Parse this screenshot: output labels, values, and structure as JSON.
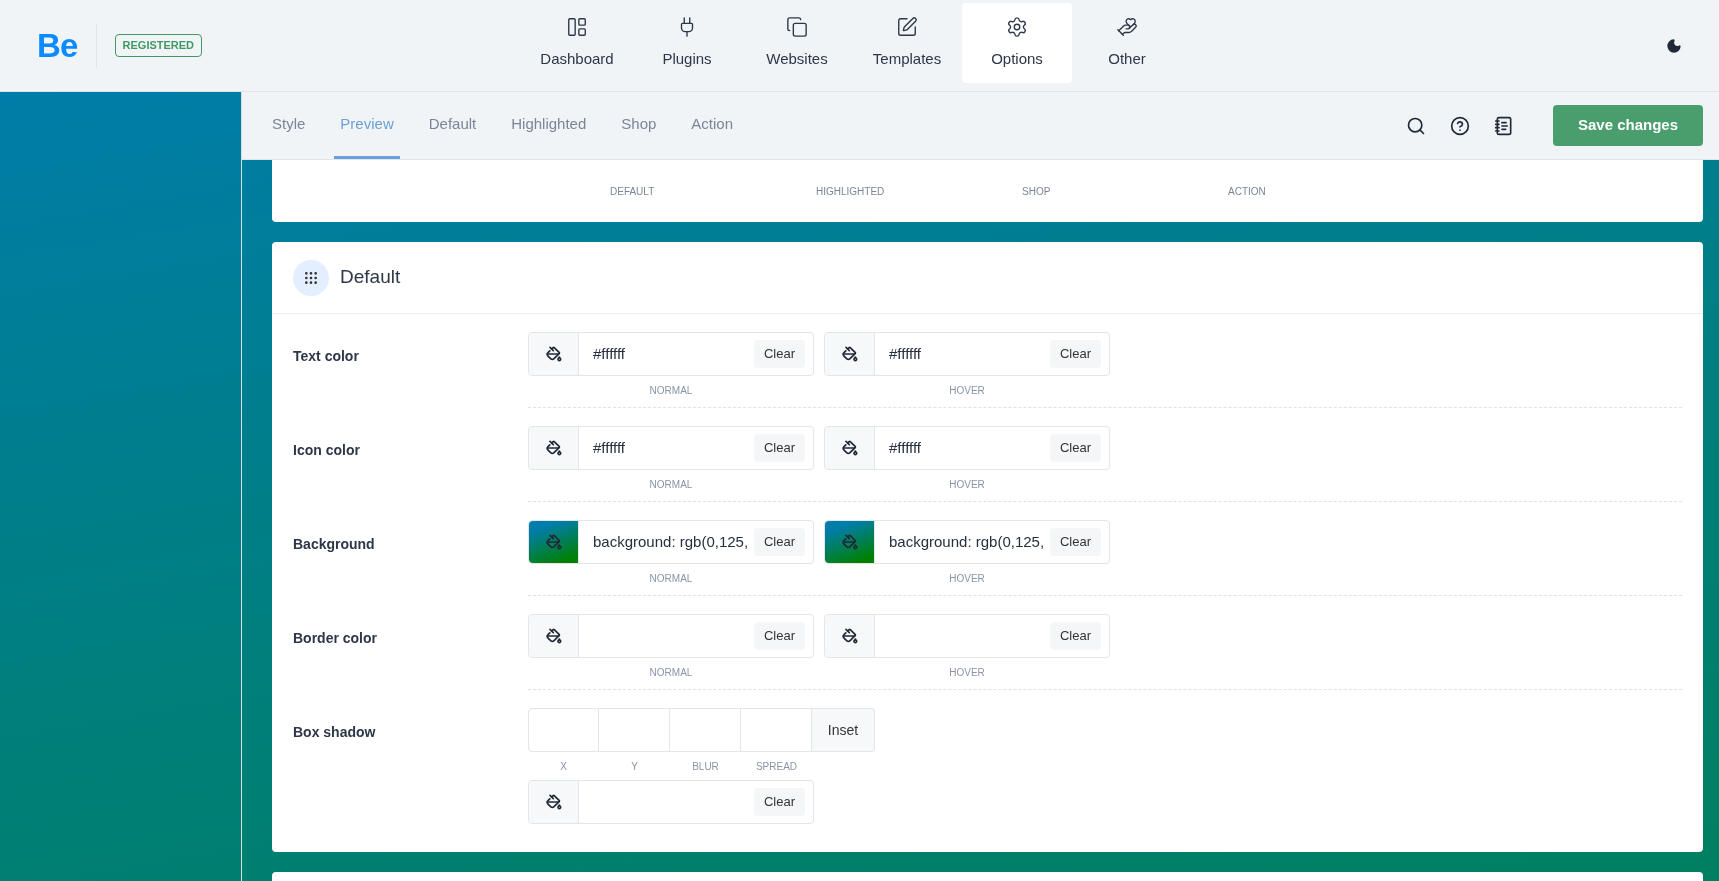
{
  "header": {
    "logo": "Be",
    "badge": "REGISTERED",
    "nav": [
      {
        "label": "Dashboard",
        "kind": "dashboard",
        "selected": false
      },
      {
        "label": "Plugins",
        "kind": "plug",
        "selected": false
      },
      {
        "label": "Websites",
        "kind": "copy",
        "selected": false
      },
      {
        "label": "Templates",
        "kind": "edit",
        "selected": false
      },
      {
        "label": "Options",
        "kind": "gear",
        "selected": true
      },
      {
        "label": "Other",
        "kind": "hand",
        "selected": false
      }
    ]
  },
  "subnav": {
    "tabs": [
      {
        "label": "Style",
        "selected": false
      },
      {
        "label": "Preview",
        "selected": true
      },
      {
        "label": "Default",
        "selected": false
      },
      {
        "label": "Highlighted",
        "selected": false
      },
      {
        "label": "Shop",
        "selected": false
      },
      {
        "label": "Action",
        "selected": false
      }
    ],
    "save_button": "Save changes"
  },
  "preview_card": {
    "labels": [
      "DEFAULT",
      "HIGHLIGHTED",
      "SHOP",
      "ACTION"
    ]
  },
  "section": {
    "title": "Default",
    "rows": [
      {
        "label": "Text color",
        "kind": "colors",
        "fields": [
          {
            "value": "#ffffff",
            "swatch": false,
            "clear": "Clear",
            "caption": "NORMAL"
          },
          {
            "value": "#ffffff",
            "swatch": false,
            "clear": "Clear",
            "caption": "HOVER"
          }
        ]
      },
      {
        "label": "Icon color",
        "kind": "colors",
        "fields": [
          {
            "value": "#ffffff",
            "swatch": false,
            "clear": "Clear",
            "caption": "NORMAL"
          },
          {
            "value": "#ffffff",
            "swatch": false,
            "clear": "Clear",
            "caption": "HOVER"
          }
        ]
      },
      {
        "label": "Background",
        "kind": "colors",
        "fields": [
          {
            "value": "background: rgb(0,125,",
            "swatch": true,
            "clear": "Clear",
            "caption": "NORMAL"
          },
          {
            "value": "background: rgb(0,125,",
            "swatch": true,
            "clear": "Clear",
            "caption": "HOVER"
          }
        ]
      },
      {
        "label": "Border color",
        "kind": "colors",
        "fields": [
          {
            "swatch": false,
            "clear": "Clear",
            "caption": "NORMAL"
          },
          {
            "swatch": false,
            "clear": "Clear",
            "caption": "HOVER"
          }
        ]
      },
      {
        "label": "Box shadow",
        "kind": "shadow",
        "inputs": [
          "X",
          "Y",
          "BLUR",
          "SPREAD"
        ],
        "inset": "Inset",
        "color_field": {
          "swatch": false,
          "clear": "Clear"
        }
      }
    ]
  }
}
